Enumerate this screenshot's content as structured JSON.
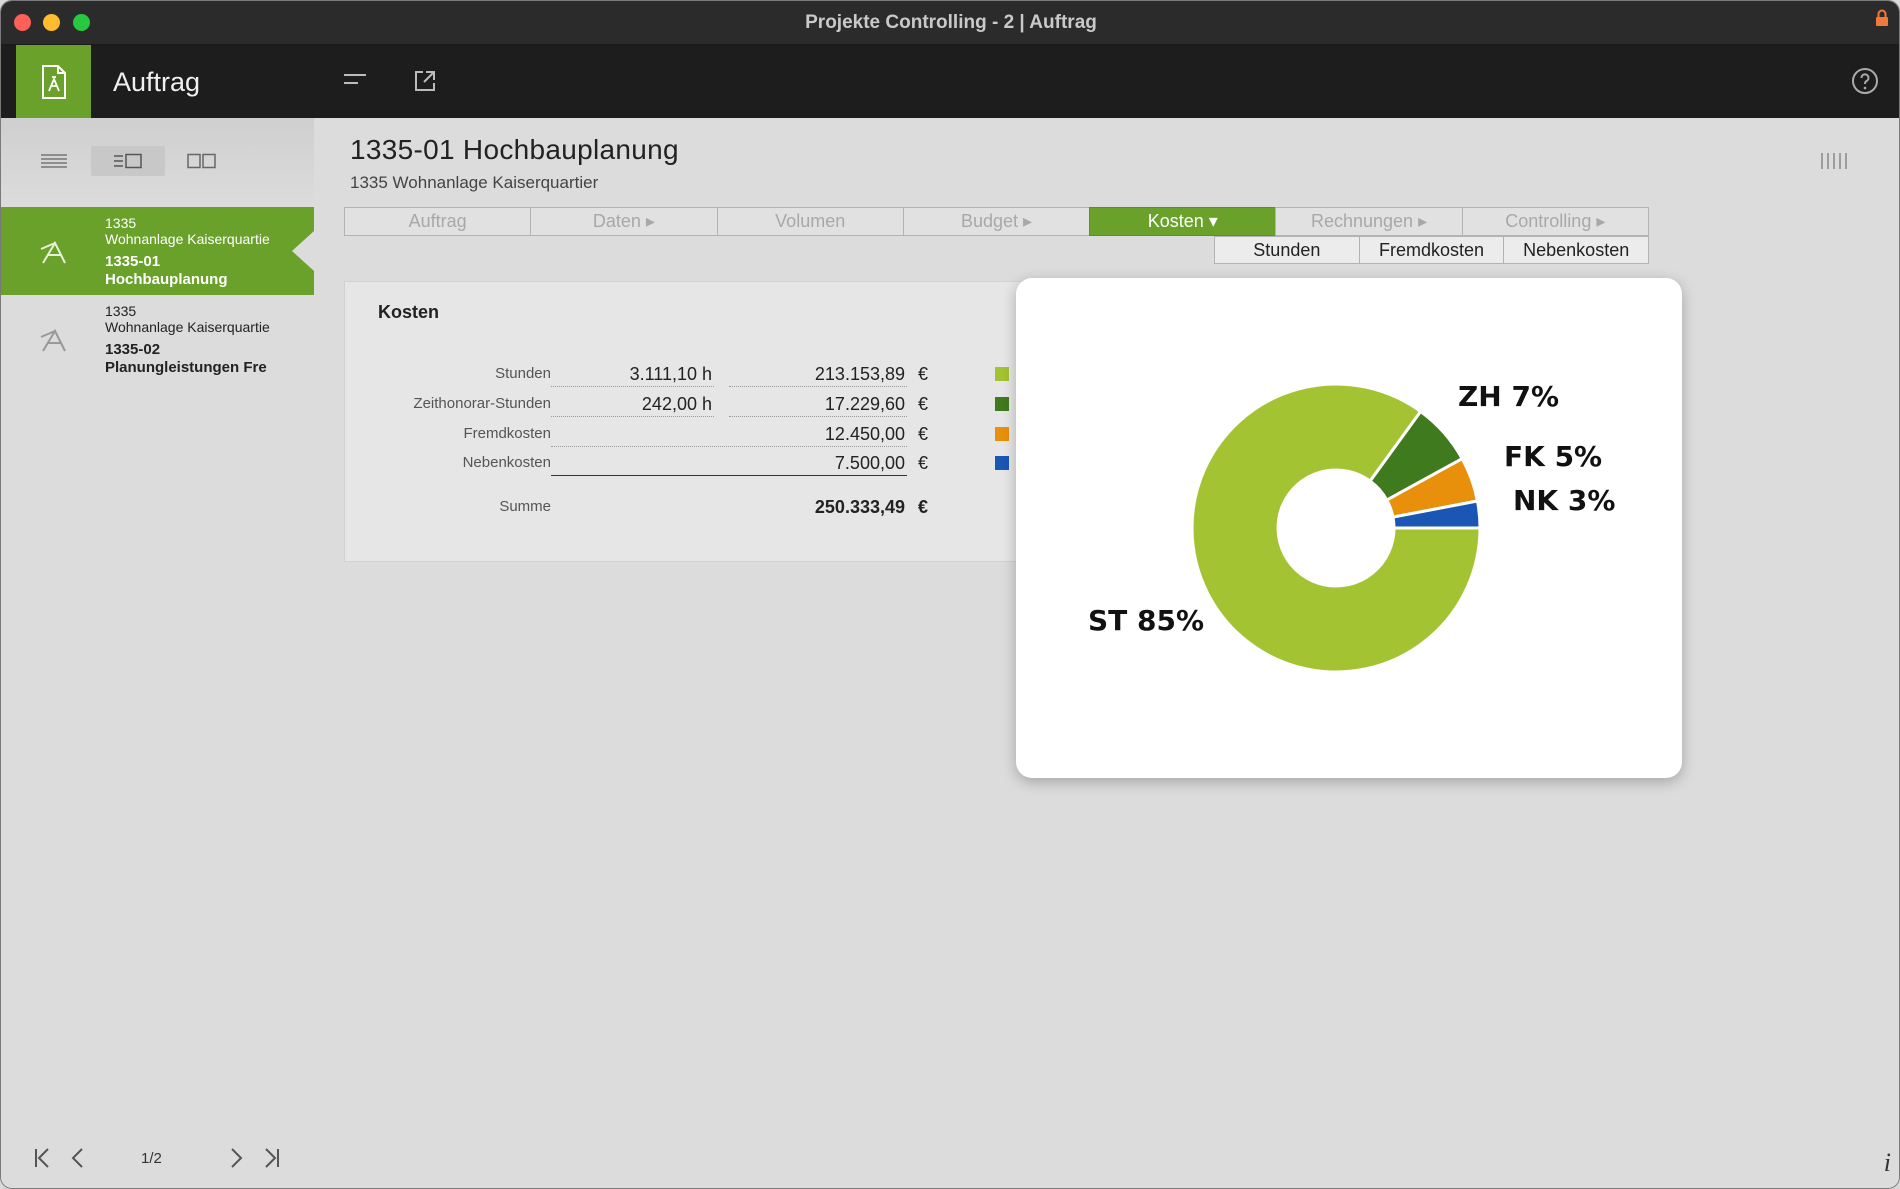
{
  "window": {
    "title": "Projekte Controlling - 2 | Auftrag"
  },
  "header": {
    "app_title": "Auftrag",
    "accent_color": "#6aa12a"
  },
  "sidebar": {
    "items": [
      {
        "line1": "1335",
        "line2": "Wohnanlage Kaiserquartie",
        "line3": "1335-01",
        "line4": "Hochbauplanung",
        "selected": true
      },
      {
        "line1": "1335",
        "line2": "Wohnanlage Kaiserquartie",
        "line3": "1335-02",
        "line4": "Planungleistungen Fre",
        "selected": false
      }
    ],
    "pager": {
      "text": "1/2"
    }
  },
  "main": {
    "title": "1335-01 Hochbauplanung",
    "subtitle": "1335 Wohnanlage Kaiserquartier",
    "tabs": [
      {
        "label": "Auftrag"
      },
      {
        "label": "Daten ▸"
      },
      {
        "label": "Volumen"
      },
      {
        "label": "Budget ▸"
      },
      {
        "label": "Kosten ▾",
        "active": true
      },
      {
        "label": "Rechnungen ▸"
      },
      {
        "label": "Controlling ▸"
      }
    ],
    "subtabs": [
      {
        "label": "Stunden"
      },
      {
        "label": "Fremdkosten"
      },
      {
        "label": "Nebenkosten"
      }
    ]
  },
  "costs": {
    "title": "Kosten",
    "currency": "€",
    "rows": [
      {
        "label": "Stunden",
        "hours": "3.111,10 h",
        "amount": "213.153,89",
        "color": "#a3c332"
      },
      {
        "label": "Zeithonorar-Stunden",
        "hours": "242,00 h",
        "amount": "17.229,60",
        "color": "#3f7a1e"
      },
      {
        "label": "Fremdkosten",
        "hours": "",
        "amount": "12.450,00",
        "color": "#e8900c"
      },
      {
        "label": "Nebenkosten",
        "hours": "",
        "amount": "7.500,00",
        "color": "#1a56b4"
      }
    ],
    "sum": {
      "label": "Summe",
      "amount": "250.333,49"
    }
  },
  "chart_data": {
    "type": "pie",
    "categories": [
      "ST",
      "ZH",
      "FK",
      "NK"
    ],
    "values": [
      85,
      7,
      5,
      3
    ],
    "labels": [
      "ST 85%",
      "ZH 7%",
      "FK 5%",
      "NK 3%"
    ],
    "colors": [
      "#a3c332",
      "#3f7a1e",
      "#e8900c",
      "#1a56b4"
    ]
  }
}
